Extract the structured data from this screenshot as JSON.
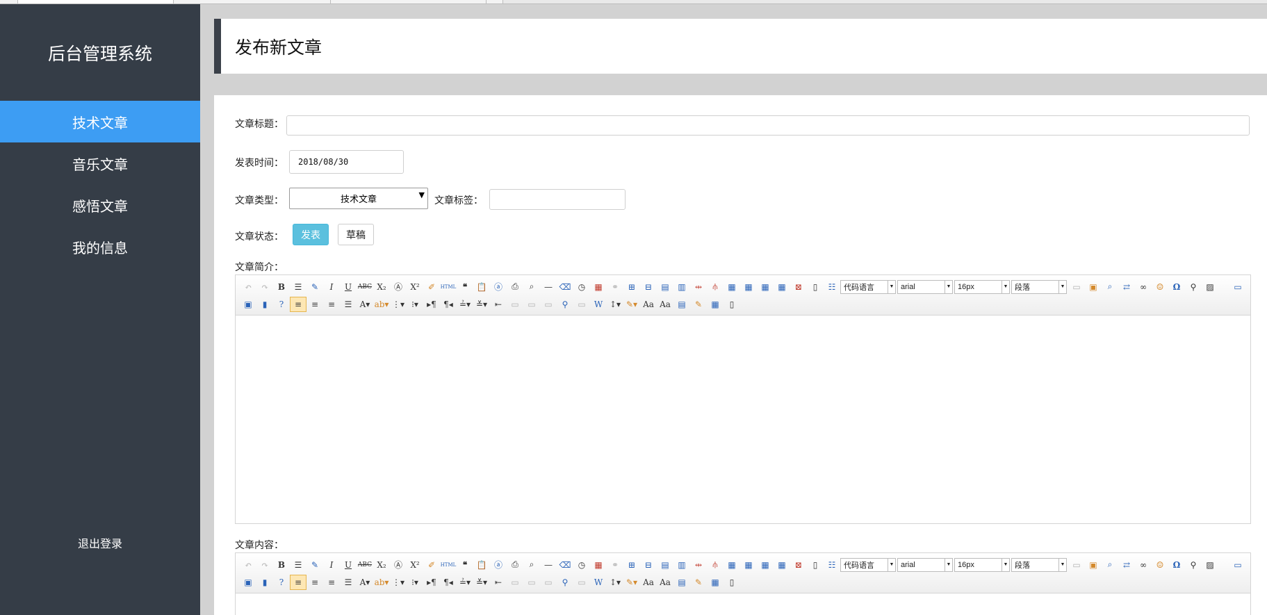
{
  "app": {
    "title": "后台管理系统"
  },
  "sidebar": {
    "items": [
      {
        "label": "技术文章",
        "active": true
      },
      {
        "label": "音乐文章",
        "active": false
      },
      {
        "label": "感悟文章",
        "active": false
      },
      {
        "label": "我的信息",
        "active": false
      }
    ],
    "logout": "退出登录"
  },
  "header": {
    "title": "发布新文章"
  },
  "form": {
    "title_label": "文章标题：",
    "title_value": "",
    "time_label": "发表时间：",
    "time_value": "2018/08/30",
    "type_label": "文章类型：",
    "type_value": "技术文章",
    "tags_label": "文章标签：",
    "tags_value": "",
    "status_label": "文章状态：",
    "publish_button": "发表",
    "draft_button": "草稿",
    "summary_label": "文章简介：",
    "content_label": "文章内容："
  },
  "editor": {
    "code_language": "代码语言",
    "font_family": "arial",
    "font_size": "16px",
    "paragraph": "段落",
    "icons": [
      "undo-icon",
      "redo-icon",
      "bold-icon",
      "indent-icon",
      "autotypeset-icon",
      "italic-icon",
      "underline-icon",
      "strikethrough-icon",
      "subscript-icon",
      "fontborder-icon",
      "superscript-icon",
      "formatmatch-icon",
      "source-html-icon",
      "blockquote-icon",
      "pasteplain-icon",
      "selectall-icon",
      "print-icon",
      "preview-icon",
      "horizontal-rule-icon",
      "removeformat-icon",
      "time-icon",
      "date-icon",
      "unlink-icon",
      "insert-row-icon",
      "insert-col-icon",
      "merge-right-icon",
      "merge-down-icon",
      "split-cell-icon",
      "split-row-icon",
      "split-col-icon",
      "table-icon",
      "delete-row-icon",
      "delete-col-icon",
      "delete-table-icon",
      "template-icon",
      "directory-icon",
      "anchor-icon",
      "image-icon",
      "insert-frame-icon",
      "search-replace-icon",
      "link-icon",
      "emotion-icon",
      "special-char-icon",
      "find-icon",
      "chart-icon",
      "fullscreen-icon"
    ]
  }
}
